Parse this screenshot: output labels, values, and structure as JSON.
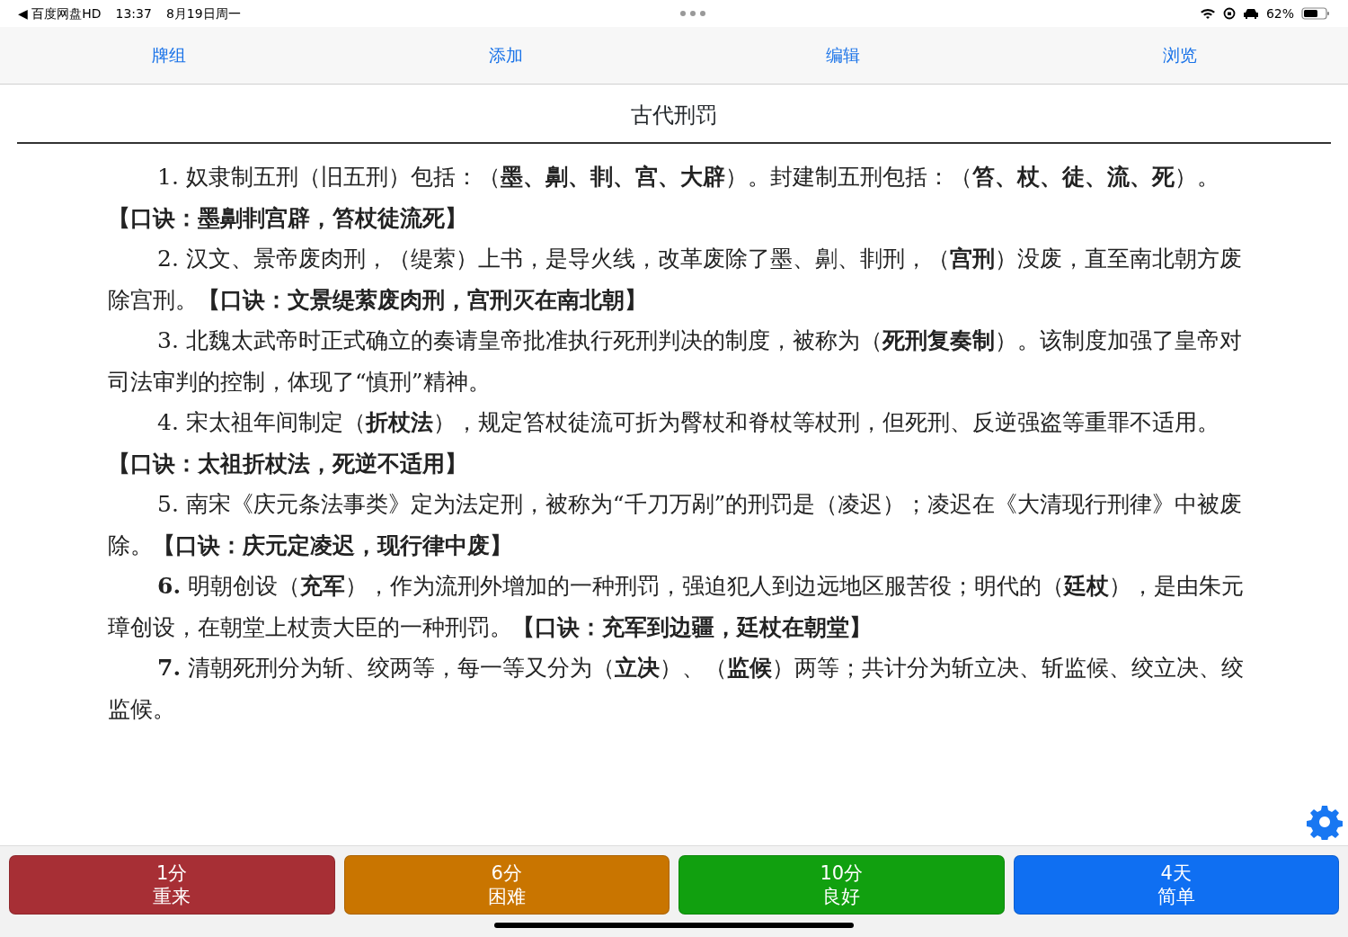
{
  "status_bar": {
    "back_app": "◀ 百度网盘HD",
    "time": "13:37",
    "date": "8月19日周一",
    "battery": "62%"
  },
  "tabs": [
    "牌组",
    "添加",
    "编辑",
    "浏览"
  ],
  "card": {
    "title": "古代刑罚",
    "paragraphs": [
      "1. 奴隶制五刑（旧五刑）包括：（**墨、劓、剕、宫、大辟**）。封建制五刑包括：（**笞、杖、徒、流、死**）。**【口诀：墨劓剕宫辟，笞杖徒流死】**",
      "2. 汉文、景帝废肉刑，（缇萦）上书，是导火线，改革废除了墨、劓、剕刑，（**宫刑**）没废，直至南北朝方废除宫刑。**【口诀：文景缇萦废肉刑，宫刑灭在南北朝】**",
      "3. 北魏太武帝时正式确立的奏请皇帝批准执行死刑判决的制度，被称为（**死刑复奏制**）。该制度加强了皇帝对司法审判的控制，体现了“慎刑”精神。",
      "4. 宋太祖年间制定（**折杖法**），规定笞杖徒流可折为臀杖和脊杖等杖刑，但死刑、反逆强盗等重罪不适用。**【口诀：太祖折杖法，死逆不适用】**",
      "5. 南宋《庆元条法事类》定为法定刑，被称为“千刀万剐”的刑罚是（凌迟）；凌迟在《大清现行刑律》中被废除。**【口诀：庆元定凌迟，现行律中废】**",
      "**6.** 明朝创设（**充军**），作为流刑外增加的一种刑罚，强迫犯人到边远地区服苦役；明代的（**廷杖**），是由朱元璋创设，在朝堂上杖责大臣的一种刑罚。**【口诀：充军到边疆，廷杖在朝堂】**",
      "**7.** 清朝死刑分为斩、绞两等，每一等又分为（**立决**）、（**监候**）两等；共计分为斩立决、斩监候、绞立决、绞监候。"
    ]
  },
  "answer_buttons": [
    {
      "kind": "again",
      "interval": "1分",
      "label": "重来"
    },
    {
      "kind": "hard",
      "interval": "6分",
      "label": "困难"
    },
    {
      "kind": "good",
      "interval": "10分",
      "label": "良好"
    },
    {
      "kind": "easy",
      "interval": "4天",
      "label": "简单"
    }
  ]
}
